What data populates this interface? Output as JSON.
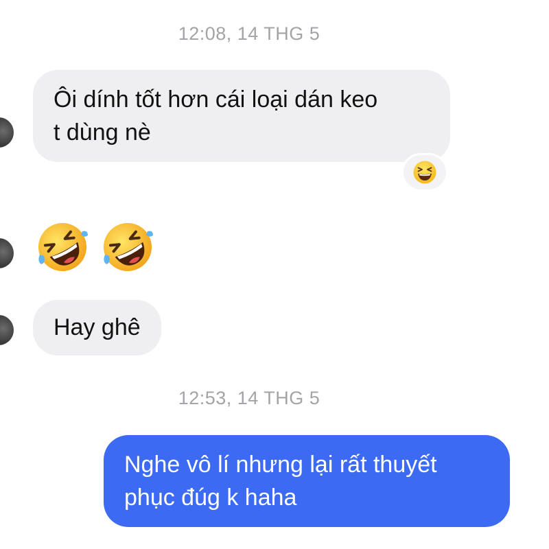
{
  "conversation": {
    "timestamp_1": "12:08, 14 THG 5",
    "message_1_line_1": "Ôi dính tốt hơn cái loại dán keo",
    "message_1_line_2": "t dùng nè",
    "message_1_reaction": "laughing-squinting-emoji",
    "message_2_emojis": [
      "rolling-on-floor-laughing-emoji",
      "rolling-on-floor-laughing-emoji"
    ],
    "message_3": "Hay ghê",
    "timestamp_2": "12:53, 14 THG 5",
    "message_4_line_1": "Nghe vô lí nhưng lại rất thuyết",
    "message_4_line_2": "phục đúg k haha"
  },
  "colors": {
    "incoming_bubble": "#efeff1",
    "outgoing_bubble": "#3d6af3",
    "timestamp_text": "#a3a3a8"
  }
}
